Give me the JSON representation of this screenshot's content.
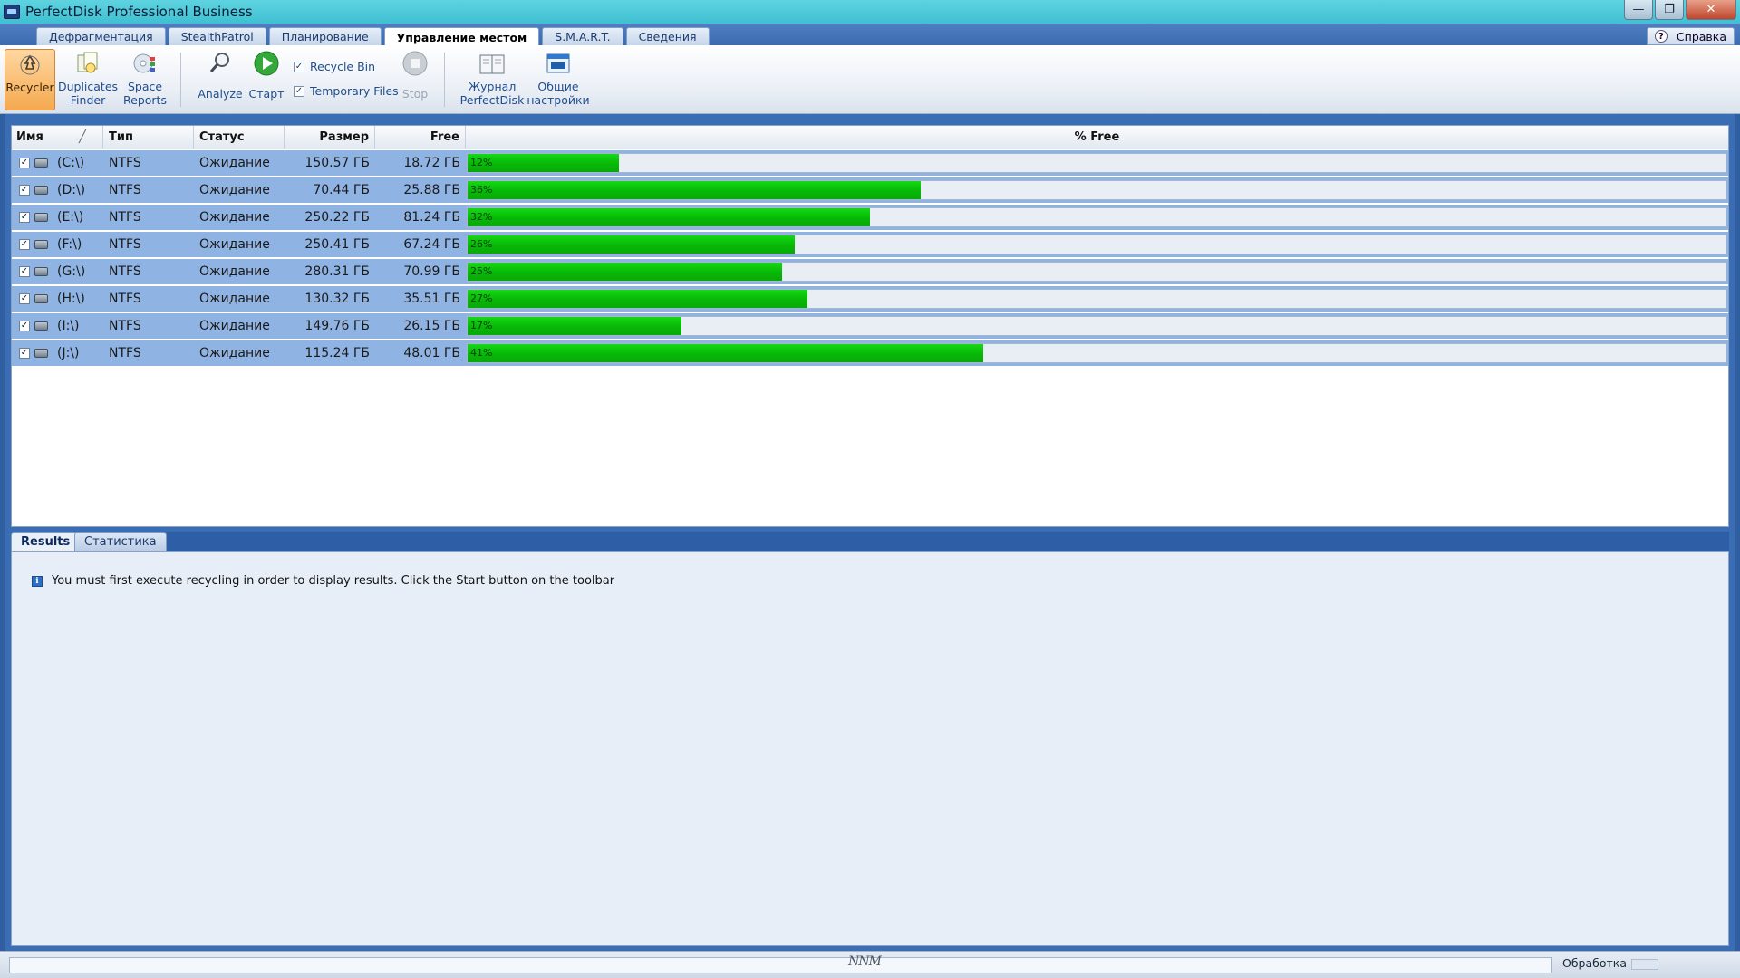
{
  "window": {
    "title": "PerfectDisk Professional Business",
    "controls": {
      "minimize": "—",
      "maximize": "❐",
      "close": "✕"
    }
  },
  "tabs": [
    {
      "label": "Дефрагментация",
      "active": false
    },
    {
      "label": "StealthPatrol",
      "active": false
    },
    {
      "label": "Планирование",
      "active": false
    },
    {
      "label": "Управление местом",
      "active": true
    },
    {
      "label": "S.M.A.R.T.",
      "active": false
    },
    {
      "label": "Сведения",
      "active": false
    }
  ],
  "help": {
    "icon": "?",
    "label": "Справка"
  },
  "toolbar": {
    "recycler": "Recycler",
    "duplicates": [
      "Duplicates",
      "Finder"
    ],
    "space_reports": [
      "Space",
      "Reports"
    ],
    "analyze": "Analyze",
    "start": "Старт",
    "recycle_bin": "Recycle Bin",
    "temporary_files": "Temporary Files",
    "stop": "Stop",
    "journal": [
      "Журнал",
      "PerfectDisk"
    ],
    "settings": [
      "Общие",
      "настройки"
    ]
  },
  "grid": {
    "columns": {
      "name": "Имя",
      "sort": "╱",
      "type": "Тип",
      "status": "Статус",
      "size": "Размер",
      "free": "Free",
      "pct_free": "% Free"
    },
    "rows": [
      {
        "name": "(C:\\)",
        "type": "NTFS",
        "status": "Ожидание",
        "size": "150.57 ГБ",
        "free": "18.72 ГБ",
        "pct_label": "12%",
        "pct": 12
      },
      {
        "name": "(D:\\)",
        "type": "NTFS",
        "status": "Ожидание",
        "size": "70.44 ГБ",
        "free": "25.88 ГБ",
        "pct_label": "36%",
        "pct": 36
      },
      {
        "name": "(E:\\)",
        "type": "NTFS",
        "status": "Ожидание",
        "size": "250.22 ГБ",
        "free": "81.24 ГБ",
        "pct_label": "32%",
        "pct": 32
      },
      {
        "name": "(F:\\)",
        "type": "NTFS",
        "status": "Ожидание",
        "size": "250.41 ГБ",
        "free": "67.24 ГБ",
        "pct_label": "26%",
        "pct": 26
      },
      {
        "name": "(G:\\)",
        "type": "NTFS",
        "status": "Ожидание",
        "size": "280.31 ГБ",
        "free": "70.99 ГБ",
        "pct_label": "25%",
        "pct": 25
      },
      {
        "name": "(H:\\)",
        "type": "NTFS",
        "status": "Ожидание",
        "size": "130.32 ГБ",
        "free": "35.51 ГБ",
        "pct_label": "27%",
        "pct": 27
      },
      {
        "name": "(I:\\)",
        "type": "NTFS",
        "status": "Ожидание",
        "size": "149.76 ГБ",
        "free": "26.15 ГБ",
        "pct_label": "17%",
        "pct": 17
      },
      {
        "name": "(J:\\)",
        "type": "NTFS",
        "status": "Ожидание",
        "size": "115.24 ГБ",
        "free": "48.01 ГБ",
        "pct_label": "41%",
        "pct": 41
      }
    ]
  },
  "bottom_tabs": [
    {
      "label": "Results",
      "active": true
    },
    {
      "label": "Статистика",
      "active": false
    }
  ],
  "results": {
    "info_icon": "i",
    "message": "You must first execute recycling in order to display results. Click the Start button on the toolbar"
  },
  "status": {
    "logo": "NNM",
    "label": "Обработка"
  },
  "colors": {
    "accent": "#3a6db3",
    "bar": "#0bbf0b",
    "selection": "#8fb4e4"
  }
}
